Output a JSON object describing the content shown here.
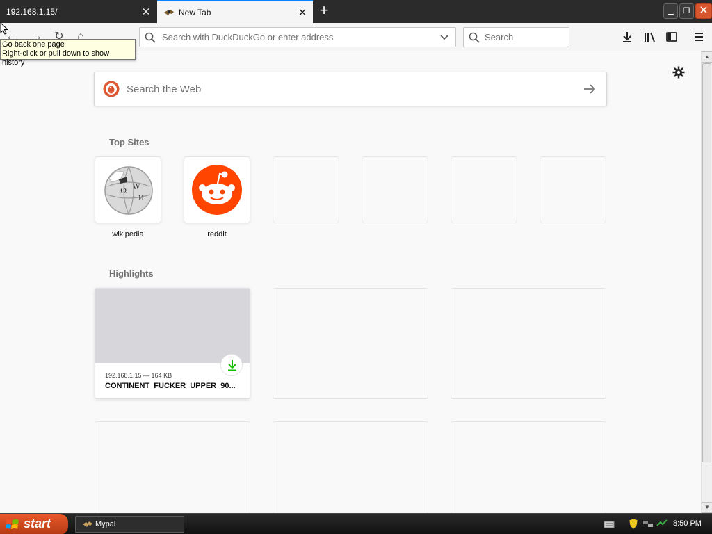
{
  "tabs": [
    {
      "title": "192.168.1.15/",
      "active": false
    },
    {
      "title": "New Tab",
      "active": true
    }
  ],
  "urlbar": {
    "placeholder": "Search with DuckDuckGo or enter address"
  },
  "searchbar": {
    "placeholder": "Search"
  },
  "tooltip": {
    "line1": "Go back one page",
    "line2": "Right-click or pull down to show history"
  },
  "web_search": {
    "placeholder": "Search the Web"
  },
  "top_sites": {
    "title": "Top Sites",
    "sites": [
      {
        "name": "wikipedia",
        "icon": "wikipedia-globe-icon"
      },
      {
        "name": "reddit",
        "icon": "reddit-alien-icon"
      },
      {
        "name": ""
      },
      {
        "name": ""
      },
      {
        "name": ""
      },
      {
        "name": ""
      }
    ]
  },
  "highlights": {
    "title": "Highlights",
    "cards": [
      {
        "meta": "192.168.1.15 — 164 KB",
        "title": "CONTINENT_FUCKER_UPPER_90...",
        "type": "download"
      }
    ]
  },
  "taskbar": {
    "start_label": "start",
    "task_label": "Mypal",
    "clock": "8:50 PM"
  },
  "colors": {
    "accent": "#0a84ff",
    "reddit": "#ff4500",
    "download_green": "#12bc00",
    "start": "#d8562e"
  }
}
